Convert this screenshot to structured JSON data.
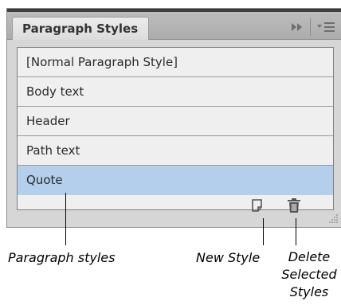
{
  "panel": {
    "tab_label": "Paragraph Styles",
    "collapse_icon": "double-chevron-right-icon",
    "menu_icon": "panel-menu-icon"
  },
  "styles": [
    {
      "label": "[Normal Paragraph Style]",
      "selected": false
    },
    {
      "label": "Body text",
      "selected": false
    },
    {
      "label": "Header",
      "selected": false
    },
    {
      "label": "Path text",
      "selected": false
    },
    {
      "label": "Quote",
      "selected": true
    }
  ],
  "footer": {
    "new_style_icon": "new-style-icon",
    "delete_icon": "trash-icon"
  },
  "callouts": {
    "paragraph_styles": "Paragraph styles",
    "new_style": "New Style",
    "delete_line1": "Delete",
    "delete_line2": "Selected",
    "delete_line3": "Styles"
  },
  "colors": {
    "selected_row": "#b3cfec",
    "panel_bg": "#d6d6d6"
  }
}
